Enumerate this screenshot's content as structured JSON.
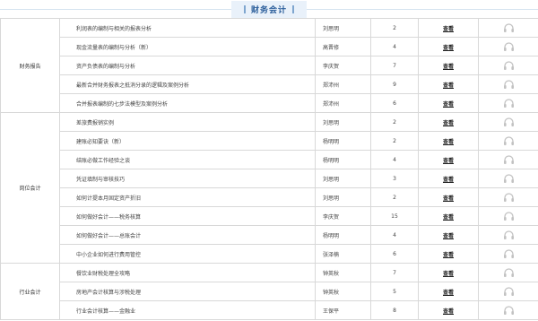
{
  "banner": {
    "title": "财务会计"
  },
  "icons": {
    "headphones": "headphones-icon"
  },
  "groups": [
    {
      "category": "财务报告",
      "rows": [
        {
          "title": "利润表的编制与相关的报表分析",
          "lecturer": "刘思明",
          "count": "2",
          "view": "查看"
        },
        {
          "title": "现金流量表的编制与分析（新）",
          "lecturer": "高晋修",
          "count": "4",
          "view": "查看"
        },
        {
          "title": "资产负债表的编制与分析",
          "lecturer": "李庆贺",
          "count": "7",
          "view": "查看"
        },
        {
          "title": "最新合并财务报表之抵消分录的逻辑及案例分析",
          "lecturer": "郑沛州",
          "count": "9",
          "view": "查看"
        },
        {
          "title": "合并报表编制的七步法模型及案例分析",
          "lecturer": "郑沛州",
          "count": "6",
          "view": "查看"
        }
      ]
    },
    {
      "category": "岗位会计",
      "rows": [
        {
          "title": "差旅费报销实例",
          "lecturer": "刘思明",
          "count": "2",
          "view": "查看"
        },
        {
          "title": "建账必知要诀（新）",
          "lecturer": "杨明明",
          "count": "2",
          "view": "查看"
        },
        {
          "title": "结账必做工作经验之谈",
          "lecturer": "杨明明",
          "count": "4",
          "view": "查看"
        },
        {
          "title": "凭证填制与审核技巧",
          "lecturer": "刘思明",
          "count": "3",
          "view": "查看"
        },
        {
          "title": "如何计提本月固定资产折旧",
          "lecturer": "刘思明",
          "count": "2",
          "view": "查看"
        },
        {
          "title": "如何做好会计——税务核算",
          "lecturer": "李庆贺",
          "count": "15",
          "view": "查看"
        },
        {
          "title": "如何做好会计——总账会计",
          "lecturer": "杨明明",
          "count": "4",
          "view": "查看"
        },
        {
          "title": "中小企业如何进行费用管控",
          "lecturer": "张泽楠",
          "count": "6",
          "view": "查看"
        }
      ]
    },
    {
      "category": "行业会计",
      "rows": [
        {
          "title": "餐饮业财税处理全攻略",
          "lecturer": "钟英秋",
          "count": "7",
          "view": "查看"
        },
        {
          "title": "房地产会计核算与涉税处理",
          "lecturer": "钟英秋",
          "count": "5",
          "view": "查看"
        },
        {
          "title": "行业会计核算——金融业",
          "lecturer": "王保平",
          "count": "8",
          "view": "查看"
        }
      ]
    }
  ]
}
